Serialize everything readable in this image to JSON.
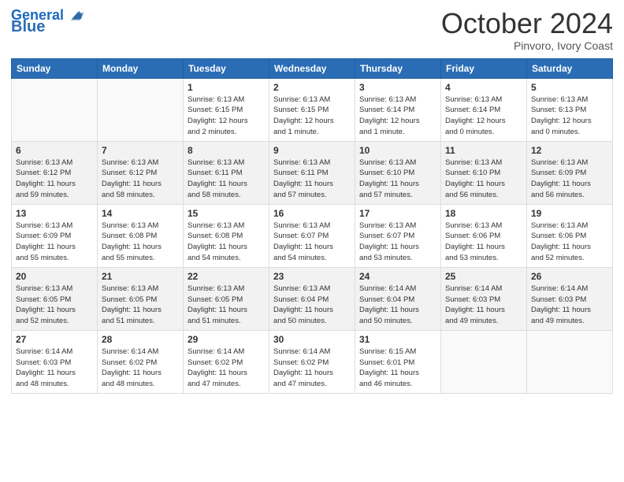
{
  "logo": {
    "text_general": "General",
    "text_blue": "Blue"
  },
  "header": {
    "month": "October 2024",
    "location": "Pinvoro, Ivory Coast"
  },
  "weekdays": [
    "Sunday",
    "Monday",
    "Tuesday",
    "Wednesday",
    "Thursday",
    "Friday",
    "Saturday"
  ],
  "weeks": [
    [
      {
        "day": "",
        "info": ""
      },
      {
        "day": "",
        "info": ""
      },
      {
        "day": "1",
        "info": "Sunrise: 6:13 AM\nSunset: 6:15 PM\nDaylight: 12 hours\nand 2 minutes."
      },
      {
        "day": "2",
        "info": "Sunrise: 6:13 AM\nSunset: 6:15 PM\nDaylight: 12 hours\nand 1 minute."
      },
      {
        "day": "3",
        "info": "Sunrise: 6:13 AM\nSunset: 6:14 PM\nDaylight: 12 hours\nand 1 minute."
      },
      {
        "day": "4",
        "info": "Sunrise: 6:13 AM\nSunset: 6:14 PM\nDaylight: 12 hours\nand 0 minutes."
      },
      {
        "day": "5",
        "info": "Sunrise: 6:13 AM\nSunset: 6:13 PM\nDaylight: 12 hours\nand 0 minutes."
      }
    ],
    [
      {
        "day": "6",
        "info": "Sunrise: 6:13 AM\nSunset: 6:12 PM\nDaylight: 11 hours\nand 59 minutes."
      },
      {
        "day": "7",
        "info": "Sunrise: 6:13 AM\nSunset: 6:12 PM\nDaylight: 11 hours\nand 58 minutes."
      },
      {
        "day": "8",
        "info": "Sunrise: 6:13 AM\nSunset: 6:11 PM\nDaylight: 11 hours\nand 58 minutes."
      },
      {
        "day": "9",
        "info": "Sunrise: 6:13 AM\nSunset: 6:11 PM\nDaylight: 11 hours\nand 57 minutes."
      },
      {
        "day": "10",
        "info": "Sunrise: 6:13 AM\nSunset: 6:10 PM\nDaylight: 11 hours\nand 57 minutes."
      },
      {
        "day": "11",
        "info": "Sunrise: 6:13 AM\nSunset: 6:10 PM\nDaylight: 11 hours\nand 56 minutes."
      },
      {
        "day": "12",
        "info": "Sunrise: 6:13 AM\nSunset: 6:09 PM\nDaylight: 11 hours\nand 56 minutes."
      }
    ],
    [
      {
        "day": "13",
        "info": "Sunrise: 6:13 AM\nSunset: 6:09 PM\nDaylight: 11 hours\nand 55 minutes."
      },
      {
        "day": "14",
        "info": "Sunrise: 6:13 AM\nSunset: 6:08 PM\nDaylight: 11 hours\nand 55 minutes."
      },
      {
        "day": "15",
        "info": "Sunrise: 6:13 AM\nSunset: 6:08 PM\nDaylight: 11 hours\nand 54 minutes."
      },
      {
        "day": "16",
        "info": "Sunrise: 6:13 AM\nSunset: 6:07 PM\nDaylight: 11 hours\nand 54 minutes."
      },
      {
        "day": "17",
        "info": "Sunrise: 6:13 AM\nSunset: 6:07 PM\nDaylight: 11 hours\nand 53 minutes."
      },
      {
        "day": "18",
        "info": "Sunrise: 6:13 AM\nSunset: 6:06 PM\nDaylight: 11 hours\nand 53 minutes."
      },
      {
        "day": "19",
        "info": "Sunrise: 6:13 AM\nSunset: 6:06 PM\nDaylight: 11 hours\nand 52 minutes."
      }
    ],
    [
      {
        "day": "20",
        "info": "Sunrise: 6:13 AM\nSunset: 6:05 PM\nDaylight: 11 hours\nand 52 minutes."
      },
      {
        "day": "21",
        "info": "Sunrise: 6:13 AM\nSunset: 6:05 PM\nDaylight: 11 hours\nand 51 minutes."
      },
      {
        "day": "22",
        "info": "Sunrise: 6:13 AM\nSunset: 6:05 PM\nDaylight: 11 hours\nand 51 minutes."
      },
      {
        "day": "23",
        "info": "Sunrise: 6:13 AM\nSunset: 6:04 PM\nDaylight: 11 hours\nand 50 minutes."
      },
      {
        "day": "24",
        "info": "Sunrise: 6:14 AM\nSunset: 6:04 PM\nDaylight: 11 hours\nand 50 minutes."
      },
      {
        "day": "25",
        "info": "Sunrise: 6:14 AM\nSunset: 6:03 PM\nDaylight: 11 hours\nand 49 minutes."
      },
      {
        "day": "26",
        "info": "Sunrise: 6:14 AM\nSunset: 6:03 PM\nDaylight: 11 hours\nand 49 minutes."
      }
    ],
    [
      {
        "day": "27",
        "info": "Sunrise: 6:14 AM\nSunset: 6:03 PM\nDaylight: 11 hours\nand 48 minutes."
      },
      {
        "day": "28",
        "info": "Sunrise: 6:14 AM\nSunset: 6:02 PM\nDaylight: 11 hours\nand 48 minutes."
      },
      {
        "day": "29",
        "info": "Sunrise: 6:14 AM\nSunset: 6:02 PM\nDaylight: 11 hours\nand 47 minutes."
      },
      {
        "day": "30",
        "info": "Sunrise: 6:14 AM\nSunset: 6:02 PM\nDaylight: 11 hours\nand 47 minutes."
      },
      {
        "day": "31",
        "info": "Sunrise: 6:15 AM\nSunset: 6:01 PM\nDaylight: 11 hours\nand 46 minutes."
      },
      {
        "day": "",
        "info": ""
      },
      {
        "day": "",
        "info": ""
      }
    ]
  ]
}
